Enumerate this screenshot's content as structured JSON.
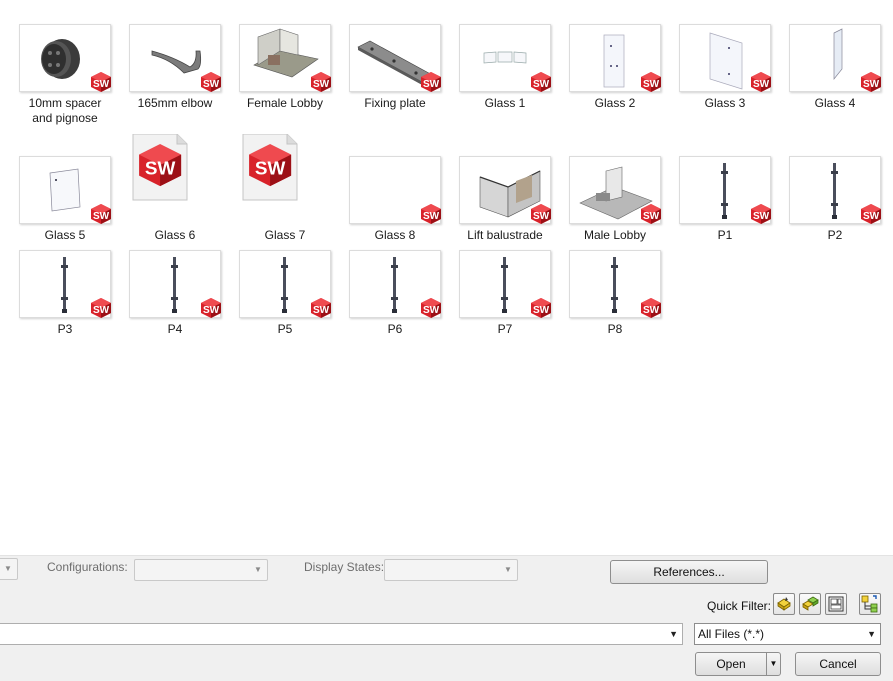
{
  "files": [
    {
      "label": "10mm spacer\nand pignose",
      "thumb": "spacer"
    },
    {
      "label": "165mm elbow",
      "thumb": "elbow"
    },
    {
      "label": "Female Lobby",
      "thumb": "lobby-female"
    },
    {
      "label": "Fixing plate",
      "thumb": "plate"
    },
    {
      "label": "Glass 1",
      "thumb": "glass1"
    },
    {
      "label": "Glass 2",
      "thumb": "glass2"
    },
    {
      "label": "Glass 3",
      "thumb": "glass3"
    },
    {
      "label": "Glass 4",
      "thumb": "glass4"
    },
    {
      "label": "Glass 5",
      "thumb": "glass5"
    },
    {
      "label": "Glass 6",
      "thumb": "doc"
    },
    {
      "label": "Glass 7",
      "thumb": "doc"
    },
    {
      "label": "Glass 8",
      "thumb": "blank"
    },
    {
      "label": "Lift balustrade",
      "thumb": "lift"
    },
    {
      "label": "Male Lobby",
      "thumb": "lobby-male"
    },
    {
      "label": "P1",
      "thumb": "post"
    },
    {
      "label": "P2",
      "thumb": "post"
    },
    {
      "label": "P3",
      "thumb": "post"
    },
    {
      "label": "P4",
      "thumb": "post"
    },
    {
      "label": "P5",
      "thumb": "post"
    },
    {
      "label": "P6",
      "thumb": "post"
    },
    {
      "label": "P7",
      "thumb": "post"
    },
    {
      "label": "P8",
      "thumb": "post"
    }
  ],
  "badge_text": "SW",
  "colors": {
    "badge_red": "#d8222a",
    "badge_dark": "#9c1016",
    "panel_bg": "#f0f0f0"
  },
  "bottom": {
    "configurations_label": "Configurations:",
    "display_states_label": "Display States:",
    "references_button": "References...",
    "quick_filter_label": "Quick Filter:",
    "quick_filter_icons": [
      "filter-parts-icon",
      "filter-assemblies-icon",
      "filter-drawings-icon",
      "filter-top-level-icon"
    ],
    "filename_value": "",
    "file_type_value": "All Files (*.*)",
    "open_button": "Open",
    "cancel_button": "Cancel"
  }
}
